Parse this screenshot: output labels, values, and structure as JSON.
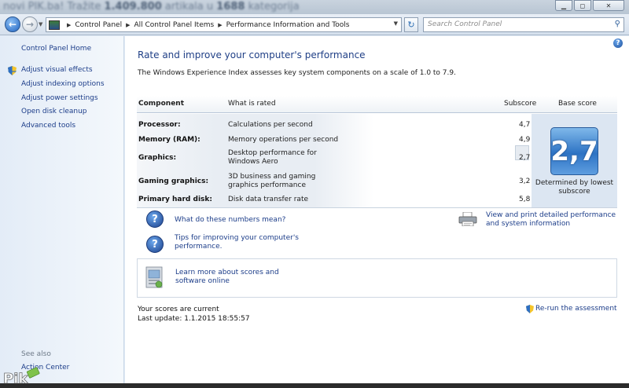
{
  "background_page": {
    "blurred_text_prefix": "novi PIK.ba! Tražite",
    "blurred_count_articles": "1.409.800",
    "blurred_mid": "artikala u",
    "blurred_count_categories": "1688",
    "blurred_suffix": "kategorija"
  },
  "address_bar": {
    "crumbs": [
      "Control Panel",
      "All Control Panel Items",
      "Performance Information and Tools"
    ]
  },
  "search": {
    "placeholder": "Search Control Panel"
  },
  "left_pane": {
    "home": "Control Panel Home",
    "tasks": [
      "Adjust visual effects",
      "Adjust indexing options",
      "Adjust power settings",
      "Open disk cleanup",
      "Advanced tools"
    ],
    "see_also_label": "See also",
    "see_also_items": [
      "Action Center"
    ]
  },
  "main": {
    "title": "Rate and improve your computer's performance",
    "description": "The Windows Experience Index assesses key system components on a scale of 1.0 to 7.9.",
    "table": {
      "headers": {
        "component": "Component",
        "what": "What is rated",
        "subscore": "Subscore",
        "base": "Base score"
      },
      "rows": [
        {
          "component": "Processor:",
          "what": "Calculations per second",
          "subscore": "4,7"
        },
        {
          "component": "Memory (RAM):",
          "what": "Memory operations per second",
          "subscore": "4,9"
        },
        {
          "component": "Graphics:",
          "what": "Desktop performance for Windows Aero",
          "subscore": "2,7"
        },
        {
          "component": "Gaming graphics:",
          "what": "3D business and gaming graphics performance",
          "subscore": "3,2"
        },
        {
          "component": "Primary hard disk:",
          "what": "Disk data transfer rate",
          "subscore": "5,8"
        }
      ],
      "base_score": "2,7",
      "base_note": "Determined by lowest subscore"
    },
    "links": {
      "numbers": "What do these numbers mean?",
      "tips": "Tips for improving your computer's performance.",
      "print": "View and print detailed performance and system information",
      "learn": "Learn more about scores and software online"
    },
    "status": {
      "current": "Your scores are current",
      "last_update": "Last update: 1.1.2015 18:55:57"
    },
    "rerun": "Re-run the assessment"
  },
  "watermark": "Pik",
  "colors": {
    "link": "#1c3d89",
    "title": "#1f3f86",
    "badge": "#2d73c4"
  }
}
